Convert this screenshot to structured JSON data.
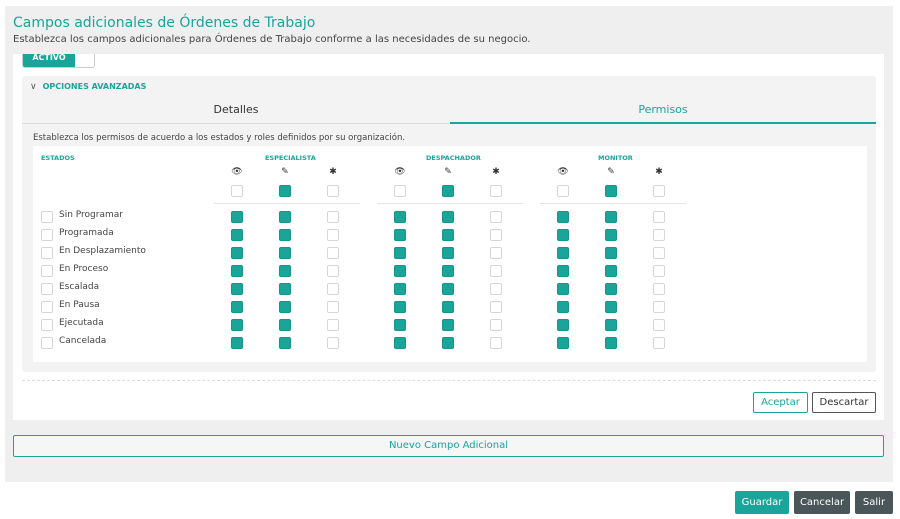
{
  "header": {
    "title": "Campos adicionales de Órdenes de Trabajo",
    "subtitle": "Establezca los campos adicionales para Órdenes de Trabajo conforme a las necesidades de su negocio."
  },
  "toggle": {
    "label": "ACTIVO",
    "on": true
  },
  "advanced": {
    "heading": "OPCIONES AVANZADAS",
    "tabs": [
      {
        "label": "Detalles",
        "active": false
      },
      {
        "label": "Permisos",
        "active": true
      }
    ],
    "description": "Establezca los permisos de acuerdo a los estados y roles definidos por su organización.",
    "states_header": "ESTADOS",
    "roles": [
      {
        "name": "ESPECIALISTA",
        "header_checks": [
          false,
          true,
          false
        ]
      },
      {
        "name": "DESPACHADOR",
        "header_checks": [
          false,
          true,
          false
        ]
      },
      {
        "name": "MONITOR",
        "header_checks": [
          false,
          true,
          false
        ]
      }
    ],
    "permission_icons": [
      "eye-icon",
      "edit-icon",
      "asterisk-icon"
    ],
    "states": [
      {
        "label": "Sin Programar",
        "checked": false,
        "perms": [
          [
            true,
            true,
            false
          ],
          [
            true,
            true,
            false
          ],
          [
            true,
            true,
            false
          ]
        ]
      },
      {
        "label": "Programada",
        "checked": false,
        "perms": [
          [
            true,
            true,
            false
          ],
          [
            true,
            true,
            false
          ],
          [
            true,
            true,
            false
          ]
        ]
      },
      {
        "label": "En Desplazamiento",
        "checked": false,
        "perms": [
          [
            true,
            true,
            false
          ],
          [
            true,
            true,
            false
          ],
          [
            true,
            true,
            false
          ]
        ]
      },
      {
        "label": "En Proceso",
        "checked": false,
        "perms": [
          [
            true,
            true,
            false
          ],
          [
            true,
            true,
            false
          ],
          [
            true,
            true,
            false
          ]
        ]
      },
      {
        "label": "Escalada",
        "checked": false,
        "perms": [
          [
            true,
            true,
            false
          ],
          [
            true,
            true,
            false
          ],
          [
            true,
            true,
            false
          ]
        ]
      },
      {
        "label": "En Pausa",
        "checked": false,
        "perms": [
          [
            true,
            true,
            false
          ],
          [
            true,
            true,
            false
          ],
          [
            true,
            true,
            false
          ]
        ]
      },
      {
        "label": "Ejecutada",
        "checked": false,
        "perms": [
          [
            true,
            true,
            false
          ],
          [
            true,
            true,
            false
          ],
          [
            true,
            true,
            false
          ]
        ]
      },
      {
        "label": "Cancelada",
        "checked": false,
        "perms": [
          [
            true,
            true,
            false
          ],
          [
            true,
            true,
            false
          ],
          [
            true,
            true,
            false
          ]
        ]
      }
    ],
    "accept_label": "Aceptar",
    "discard_label": "Descartar"
  },
  "new_field_label": "Nuevo Campo Adicional",
  "footer": {
    "save_label": "Guardar",
    "cancel_label": "Cancelar",
    "exit_label": "Salir"
  },
  "colors": {
    "accent": "#1aa49a",
    "dark_button": "#4a565a"
  }
}
